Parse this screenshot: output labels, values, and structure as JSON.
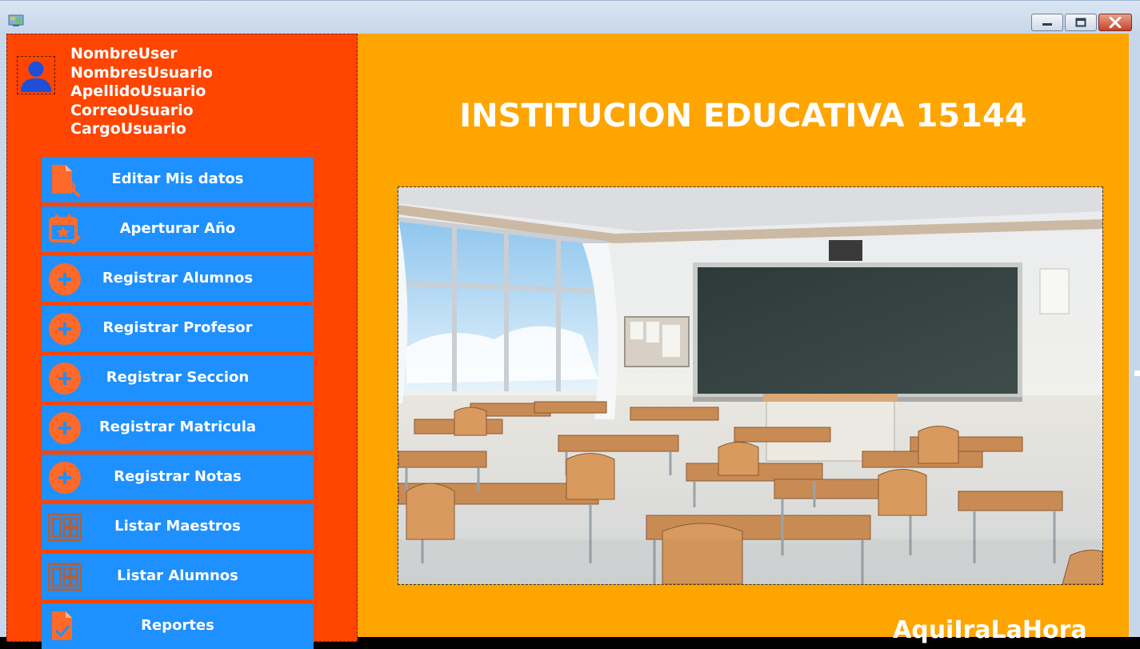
{
  "user": {
    "username": "NombreUser",
    "first_names": "NombresUsuario",
    "last_names": "ApellidoUsuario",
    "email": "CorreoUsuario",
    "role": "CargoUsuario"
  },
  "menu": [
    {
      "label": "Editar Mis datos",
      "icon": "edit-document-icon"
    },
    {
      "label": "Aperturar Año",
      "icon": "calendar-icon"
    },
    {
      "label": "Registrar Alumnos",
      "icon": "plus-circle-icon"
    },
    {
      "label": "Registrar Profesor",
      "icon": "plus-circle-icon"
    },
    {
      "label": "Registrar Seccion",
      "icon": "plus-circle-icon"
    },
    {
      "label": "Registrar Matricula",
      "icon": "plus-circle-icon"
    },
    {
      "label": "Registrar Notas",
      "icon": "plus-circle-icon"
    },
    {
      "label": "Listar Maestros",
      "icon": "list-grid-icon"
    },
    {
      "label": "Listar Alumnos",
      "icon": "list-grid-icon"
    },
    {
      "label": "Reportes",
      "icon": "report-document-icon"
    }
  ],
  "main": {
    "title": "INSTITUCION EDUCATIVA 15144",
    "clock_label": "AquiIraLaHora"
  },
  "colors": {
    "sidebar_bg": "#ff4500",
    "main_bg": "#ffa500",
    "button_bg": "#1e90ff",
    "icon_color": "#ff6a2a",
    "avatar_color": "#1e4fd8"
  }
}
